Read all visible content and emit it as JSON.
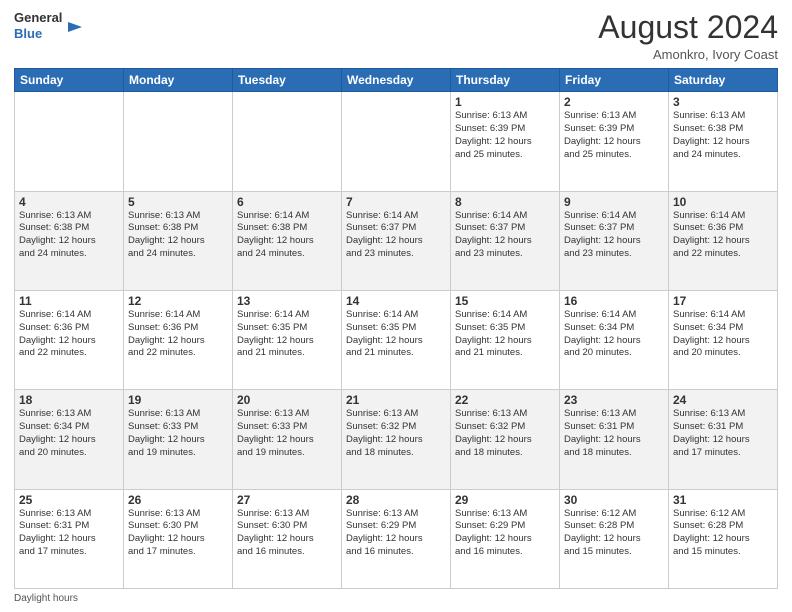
{
  "header": {
    "logo_line1": "General",
    "logo_line2": "Blue",
    "month_year": "August 2024",
    "location": "Amonkro, Ivory Coast"
  },
  "days_of_week": [
    "Sunday",
    "Monday",
    "Tuesday",
    "Wednesday",
    "Thursday",
    "Friday",
    "Saturday"
  ],
  "footer_label": "Daylight hours",
  "weeks": [
    [
      {
        "day": "",
        "info": ""
      },
      {
        "day": "",
        "info": ""
      },
      {
        "day": "",
        "info": ""
      },
      {
        "day": "",
        "info": ""
      },
      {
        "day": "1",
        "info": "Sunrise: 6:13 AM\nSunset: 6:39 PM\nDaylight: 12 hours\nand 25 minutes."
      },
      {
        "day": "2",
        "info": "Sunrise: 6:13 AM\nSunset: 6:39 PM\nDaylight: 12 hours\nand 25 minutes."
      },
      {
        "day": "3",
        "info": "Sunrise: 6:13 AM\nSunset: 6:38 PM\nDaylight: 12 hours\nand 24 minutes."
      }
    ],
    [
      {
        "day": "4",
        "info": "Sunrise: 6:13 AM\nSunset: 6:38 PM\nDaylight: 12 hours\nand 24 minutes."
      },
      {
        "day": "5",
        "info": "Sunrise: 6:13 AM\nSunset: 6:38 PM\nDaylight: 12 hours\nand 24 minutes."
      },
      {
        "day": "6",
        "info": "Sunrise: 6:14 AM\nSunset: 6:38 PM\nDaylight: 12 hours\nand 24 minutes."
      },
      {
        "day": "7",
        "info": "Sunrise: 6:14 AM\nSunset: 6:37 PM\nDaylight: 12 hours\nand 23 minutes."
      },
      {
        "day": "8",
        "info": "Sunrise: 6:14 AM\nSunset: 6:37 PM\nDaylight: 12 hours\nand 23 minutes."
      },
      {
        "day": "9",
        "info": "Sunrise: 6:14 AM\nSunset: 6:37 PM\nDaylight: 12 hours\nand 23 minutes."
      },
      {
        "day": "10",
        "info": "Sunrise: 6:14 AM\nSunset: 6:36 PM\nDaylight: 12 hours\nand 22 minutes."
      }
    ],
    [
      {
        "day": "11",
        "info": "Sunrise: 6:14 AM\nSunset: 6:36 PM\nDaylight: 12 hours\nand 22 minutes."
      },
      {
        "day": "12",
        "info": "Sunrise: 6:14 AM\nSunset: 6:36 PM\nDaylight: 12 hours\nand 22 minutes."
      },
      {
        "day": "13",
        "info": "Sunrise: 6:14 AM\nSunset: 6:35 PM\nDaylight: 12 hours\nand 21 minutes."
      },
      {
        "day": "14",
        "info": "Sunrise: 6:14 AM\nSunset: 6:35 PM\nDaylight: 12 hours\nand 21 minutes."
      },
      {
        "day": "15",
        "info": "Sunrise: 6:14 AM\nSunset: 6:35 PM\nDaylight: 12 hours\nand 21 minutes."
      },
      {
        "day": "16",
        "info": "Sunrise: 6:14 AM\nSunset: 6:34 PM\nDaylight: 12 hours\nand 20 minutes."
      },
      {
        "day": "17",
        "info": "Sunrise: 6:14 AM\nSunset: 6:34 PM\nDaylight: 12 hours\nand 20 minutes."
      }
    ],
    [
      {
        "day": "18",
        "info": "Sunrise: 6:13 AM\nSunset: 6:34 PM\nDaylight: 12 hours\nand 20 minutes."
      },
      {
        "day": "19",
        "info": "Sunrise: 6:13 AM\nSunset: 6:33 PM\nDaylight: 12 hours\nand 19 minutes."
      },
      {
        "day": "20",
        "info": "Sunrise: 6:13 AM\nSunset: 6:33 PM\nDaylight: 12 hours\nand 19 minutes."
      },
      {
        "day": "21",
        "info": "Sunrise: 6:13 AM\nSunset: 6:32 PM\nDaylight: 12 hours\nand 18 minutes."
      },
      {
        "day": "22",
        "info": "Sunrise: 6:13 AM\nSunset: 6:32 PM\nDaylight: 12 hours\nand 18 minutes."
      },
      {
        "day": "23",
        "info": "Sunrise: 6:13 AM\nSunset: 6:31 PM\nDaylight: 12 hours\nand 18 minutes."
      },
      {
        "day": "24",
        "info": "Sunrise: 6:13 AM\nSunset: 6:31 PM\nDaylight: 12 hours\nand 17 minutes."
      }
    ],
    [
      {
        "day": "25",
        "info": "Sunrise: 6:13 AM\nSunset: 6:31 PM\nDaylight: 12 hours\nand 17 minutes."
      },
      {
        "day": "26",
        "info": "Sunrise: 6:13 AM\nSunset: 6:30 PM\nDaylight: 12 hours\nand 17 minutes."
      },
      {
        "day": "27",
        "info": "Sunrise: 6:13 AM\nSunset: 6:30 PM\nDaylight: 12 hours\nand 16 minutes."
      },
      {
        "day": "28",
        "info": "Sunrise: 6:13 AM\nSunset: 6:29 PM\nDaylight: 12 hours\nand 16 minutes."
      },
      {
        "day": "29",
        "info": "Sunrise: 6:13 AM\nSunset: 6:29 PM\nDaylight: 12 hours\nand 16 minutes."
      },
      {
        "day": "30",
        "info": "Sunrise: 6:12 AM\nSunset: 6:28 PM\nDaylight: 12 hours\nand 15 minutes."
      },
      {
        "day": "31",
        "info": "Sunrise: 6:12 AM\nSunset: 6:28 PM\nDaylight: 12 hours\nand 15 minutes."
      }
    ]
  ]
}
